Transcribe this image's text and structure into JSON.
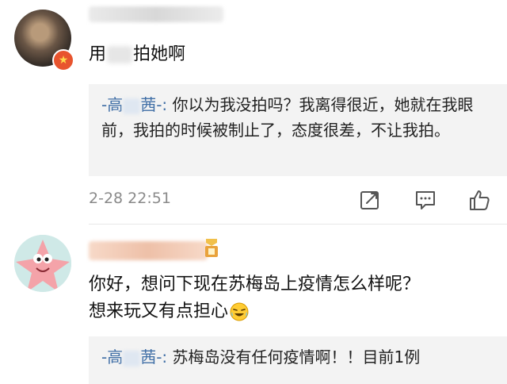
{
  "comments": [
    {
      "text_before": "用",
      "text_after": "拍她啊",
      "reply": {
        "author_start": "-高",
        "author_end": "茜-:",
        "text": "你以为我没拍吗？我离得很近，她就在我眼前，我拍的时候被制止了，态度很差，不让我拍。"
      },
      "timestamp": "2-28 22:51"
    },
    {
      "line1": "你好，想问下现在苏梅岛上疫情怎么样呢？",
      "line2": "想来玩又有点担心",
      "reply": {
        "author_start": "-高",
        "author_end": "茜-:",
        "text": "苏梅岛没有任何疫情啊！！目前1例"
      }
    }
  ],
  "icons": {
    "share": "share-icon",
    "reply": "comment-icon",
    "like": "thumbs-up-icon",
    "badge": "verified-badge-icon",
    "emoji": "laughing-crying-emoji-icon"
  },
  "colors": {
    "reply_author": "#3f6ea6",
    "reply_background": "#f3f3f3",
    "timestamp": "#8a8a8a",
    "badge": "#e8542e"
  }
}
